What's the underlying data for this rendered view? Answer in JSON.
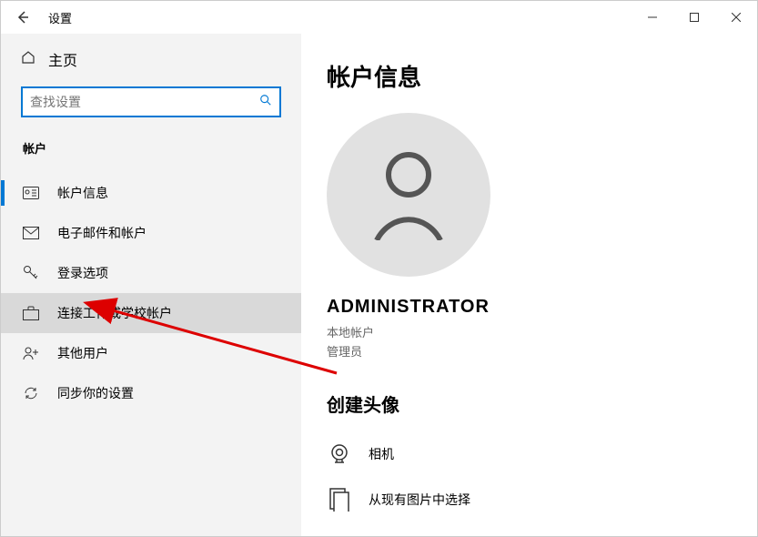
{
  "titlebar": {
    "title": "设置"
  },
  "sidebar": {
    "home_label": "主页",
    "search_placeholder": "查找设置",
    "section_label": "帐户",
    "items": [
      {
        "label": "帐户信息"
      },
      {
        "label": "电子邮件和帐户"
      },
      {
        "label": "登录选项"
      },
      {
        "label": "连接工作或学校帐户"
      },
      {
        "label": "其他用户"
      },
      {
        "label": "同步你的设置"
      }
    ]
  },
  "content": {
    "page_title": "帐户信息",
    "username": "ADMINISTRATOR",
    "account_type": "本地帐户",
    "role": "管理员",
    "create_avatar_heading": "创建头像",
    "camera_label": "相机",
    "browse_label": "从现有图片中选择"
  }
}
